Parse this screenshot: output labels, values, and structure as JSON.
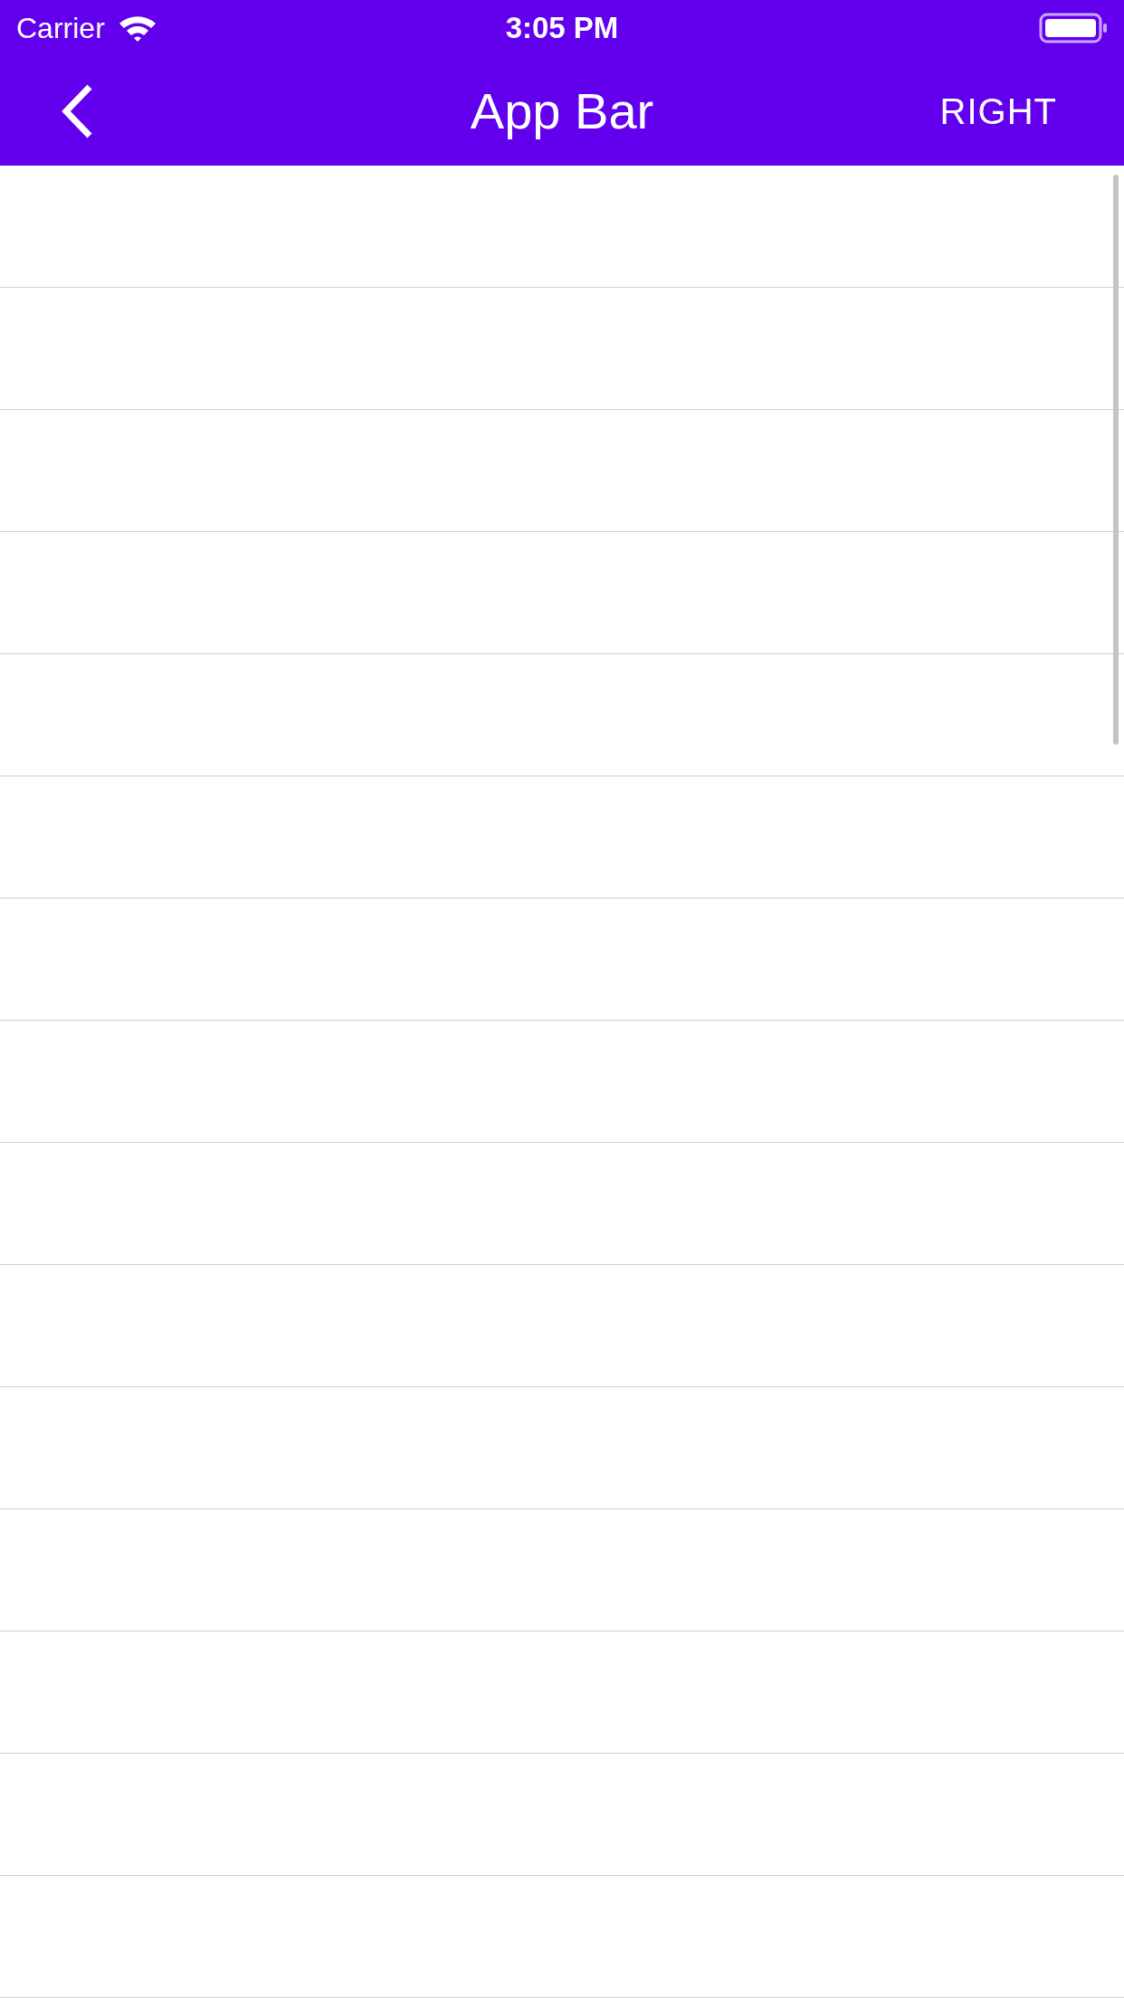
{
  "status_bar": {
    "carrier": "Carrier",
    "time": "3:05 PM"
  },
  "app_bar": {
    "title": "App Bar",
    "action": "RIGHT"
  }
}
